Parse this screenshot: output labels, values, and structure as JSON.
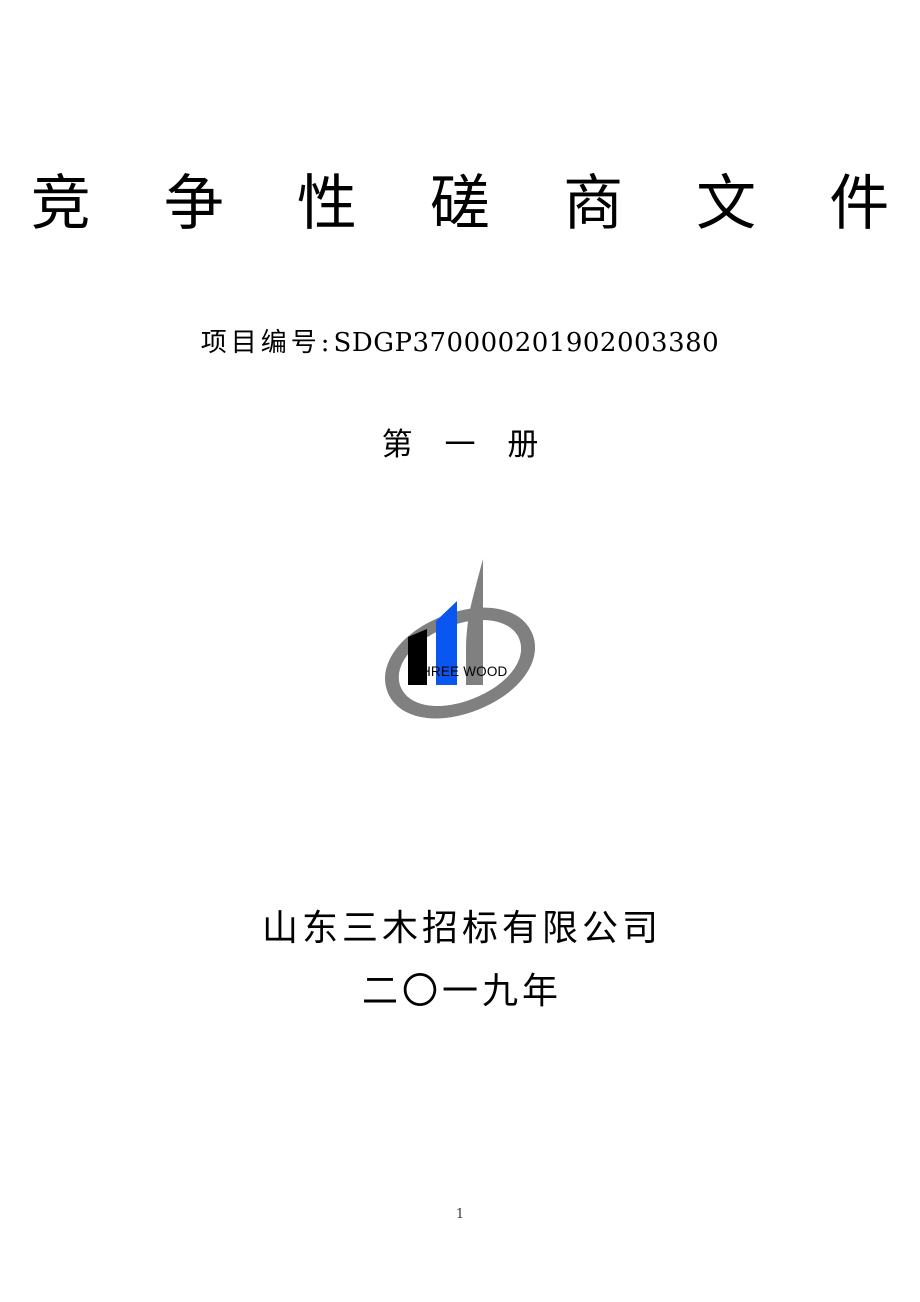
{
  "document": {
    "title": "竞 争 性 磋 商 文 件",
    "project_number_label": "项目编号:",
    "project_number_value": "SDGP370000201902003380",
    "volume": "第 一 册",
    "company": "山东三木招标有限公司",
    "year": "二〇一九年",
    "page_number": "1"
  },
  "logo": {
    "wordmark": "THREE WOOD",
    "colors": {
      "building_left": "#000000",
      "building_middle": "#0a56f0",
      "building_right": "#808080",
      "swoosh": "#808080",
      "wordmark": "#000000"
    }
  },
  "colors": {
    "page_background": "#ffffff",
    "text": "#000000",
    "page_number": "#3a3a3a"
  }
}
